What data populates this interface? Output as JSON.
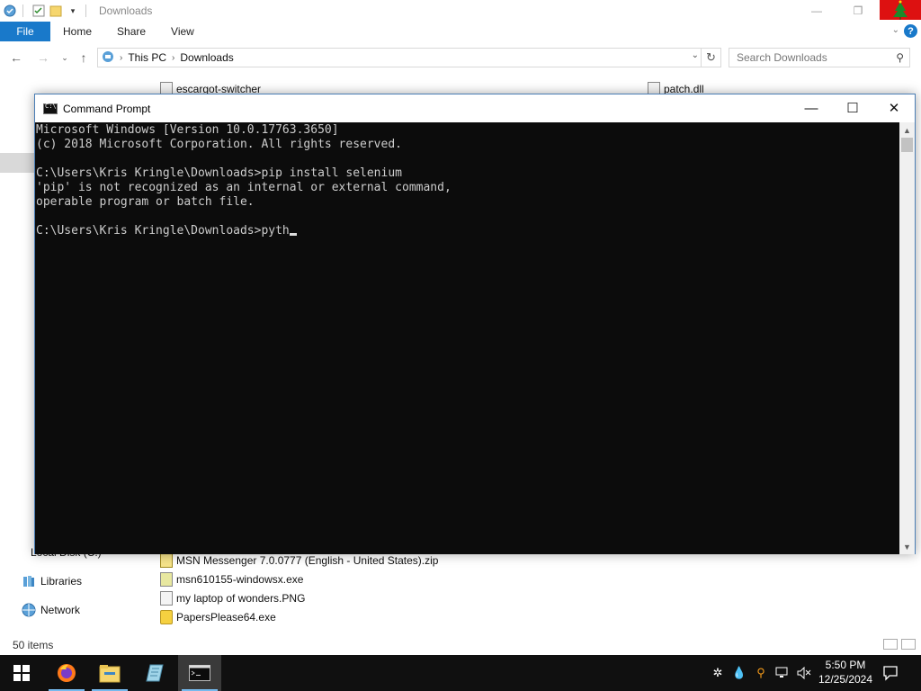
{
  "explorer": {
    "title": "Downloads",
    "ribbon_tabs": {
      "file": "File",
      "home": "Home",
      "share": "Share",
      "view": "View"
    },
    "address": {
      "this_pc": "This PC",
      "downloads": "Downloads"
    },
    "search_placeholder": "Search Downloads",
    "files_top": {
      "left": "escargot-switcher",
      "right": "patch.dll"
    },
    "files": [
      "MSN Messenger 7.0.0777 (English - United States).zip",
      "msn610155-windowsx.exe",
      "my laptop of wonders.PNG",
      "PapersPlease64.exe"
    ],
    "nav_pane": {
      "local_disk": "Local Disk (C:)",
      "libraries": "Libraries",
      "network": "Network"
    },
    "status": "50 items"
  },
  "cmd": {
    "title": "Command Prompt",
    "lines": [
      "Microsoft Windows [Version 10.0.17763.3650]",
      "(c) 2018 Microsoft Corporation. All rights reserved.",
      "",
      "C:\\Users\\Kris Kringle\\Downloads>pip install selenium",
      "'pip' is not recognized as an internal or external command,",
      "operable program or batch file.",
      "",
      "C:\\Users\\Kris Kringle\\Downloads>pyth"
    ]
  },
  "taskbar": {
    "clock_time": "5:50 PM",
    "clock_date": "12/25/2024",
    "icons": [
      "windows-start-icon",
      "firefox-icon",
      "file-explorer-icon",
      "app-icon",
      "command-prompt-icon"
    ]
  },
  "colors": {
    "accent": "#1979ca",
    "console_bg": "#0c0c0c",
    "console_fg": "#cccccc",
    "taskbar_bg": "#101010"
  }
}
